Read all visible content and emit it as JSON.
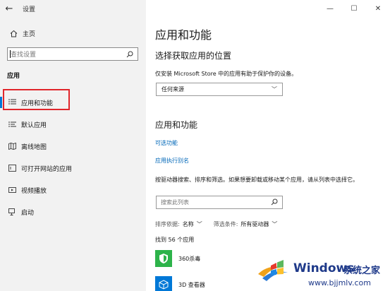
{
  "window": {
    "title": "设置",
    "back_label": "←",
    "minimize": "—",
    "maximize": "☐",
    "close": "✕"
  },
  "sidebar": {
    "home_label": "主页",
    "search_placeholder": "查找设置",
    "section_label": "应用",
    "items": [
      {
        "label": "应用和功能",
        "icon": "apps-list-icon",
        "active": true
      },
      {
        "label": "默认应用",
        "icon": "default-apps-icon"
      },
      {
        "label": "离线地图",
        "icon": "offline-maps-icon"
      },
      {
        "label": "可打开网站的应用",
        "icon": "websites-apps-icon"
      },
      {
        "label": "视频播放",
        "icon": "video-playback-icon"
      },
      {
        "label": "启动",
        "icon": "startup-icon"
      }
    ]
  },
  "main": {
    "title": "应用和功能",
    "choose_location": {
      "heading": "选择获取应用的位置",
      "desc": "仅安装 Microsoft Store 中的应用有助于保护你的设备。",
      "select_value": "任何来源"
    },
    "apps_features": {
      "heading": "应用和功能",
      "link_optional": "可选功能",
      "link_alias": "应用执行别名",
      "desc": "按驱动器搜索、排序和筛选。如果想要卸载或移动某个应用，请从列表中选择它。",
      "search_placeholder": "搜索此列表",
      "sort_label": "排序依据:",
      "sort_value": "名称",
      "filter_label": "筛选条件:",
      "filter_value": "所有驱动器",
      "count_text": "找到 56 个应用",
      "apps": [
        {
          "name": "360杀毒",
          "icon": "shield-app-icon",
          "color": "#2db34a"
        },
        {
          "name": "3D 查看器",
          "icon": "cube-app-icon",
          "color": "#0078d7"
        }
      ]
    }
  },
  "watermark": {
    "brand": "Windows",
    "cn": "系统之家",
    "url": "www.bjjmlv.com"
  }
}
